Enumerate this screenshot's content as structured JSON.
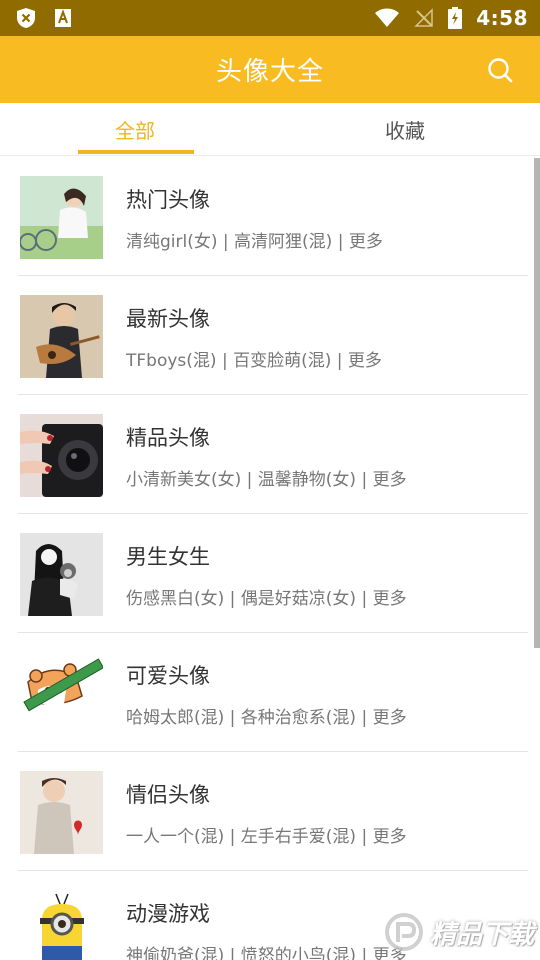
{
  "status_bar": {
    "time": "4:58"
  },
  "app_bar": {
    "title": "头像大全"
  },
  "tabs": [
    {
      "label": "全部",
      "active": true
    },
    {
      "label": "收藏",
      "active": false
    }
  ],
  "list": [
    {
      "title": "热门头像",
      "subtitle": "清纯girl(女) | 高清阿狸(混) | 更多"
    },
    {
      "title": "最新头像",
      "subtitle": "TFboys(混) | 百变脸萌(混) | 更多"
    },
    {
      "title": "精品头像",
      "subtitle": "小清新美女(女) | 温馨静物(女) | 更多"
    },
    {
      "title": "男生女生",
      "subtitle": "伤感黑白(女) | 偶是好菇凉(女) | 更多"
    },
    {
      "title": "可爱头像",
      "subtitle": "哈姆太郎(混) | 各种治愈系(混) | 更多"
    },
    {
      "title": "情侣头像",
      "subtitle": "一人一个(混) | 左手右手爱(混) | 更多"
    },
    {
      "title": "动漫游戏",
      "subtitle": "神偷奶爸(混) | 愤怒的小鸟(混) | 更多"
    }
  ],
  "watermark": {
    "text": "精品下载"
  },
  "colors": {
    "accent": "#f8bb21",
    "status_bar": "#8f6b00",
    "tab_active": "#f1b51f"
  }
}
